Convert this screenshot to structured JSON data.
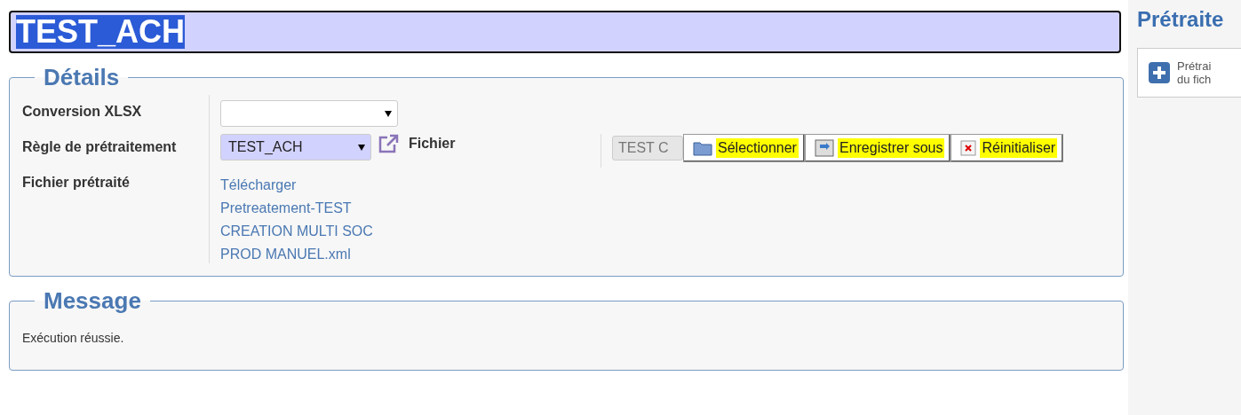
{
  "title_field": {
    "value": "TEST_ACH",
    "text_selected": true
  },
  "details": {
    "legend": "Détails",
    "conversion": {
      "label": "Conversion XLSX"
    },
    "rule": {
      "label": "Règle de prétraitement",
      "value": "TEST_ACH"
    },
    "file": {
      "label": "Fichier",
      "value": "TEST C",
      "disabled": true,
      "buttons": [
        {
          "kind": "folder",
          "label": "Sélectionner",
          "highlighted": true
        },
        {
          "kind": "save",
          "label": "Enregistrer sous",
          "highlighted": true
        },
        {
          "kind": "reset",
          "label": "Réinitialiser",
          "highlighted": true
        }
      ]
    },
    "processed": {
      "label": "Fichier prétraité",
      "links": [
        "Télécharger",
        "Pretreatement-TEST",
        "CREATION MULTI SOC",
        "PROD MANUEL.xml"
      ]
    }
  },
  "message": {
    "legend": "Message",
    "text": "Exécution réussie."
  },
  "side_panel": {
    "title": "Prétraite",
    "card_lines": [
      "Prétrai",
      "du fich"
    ]
  }
}
